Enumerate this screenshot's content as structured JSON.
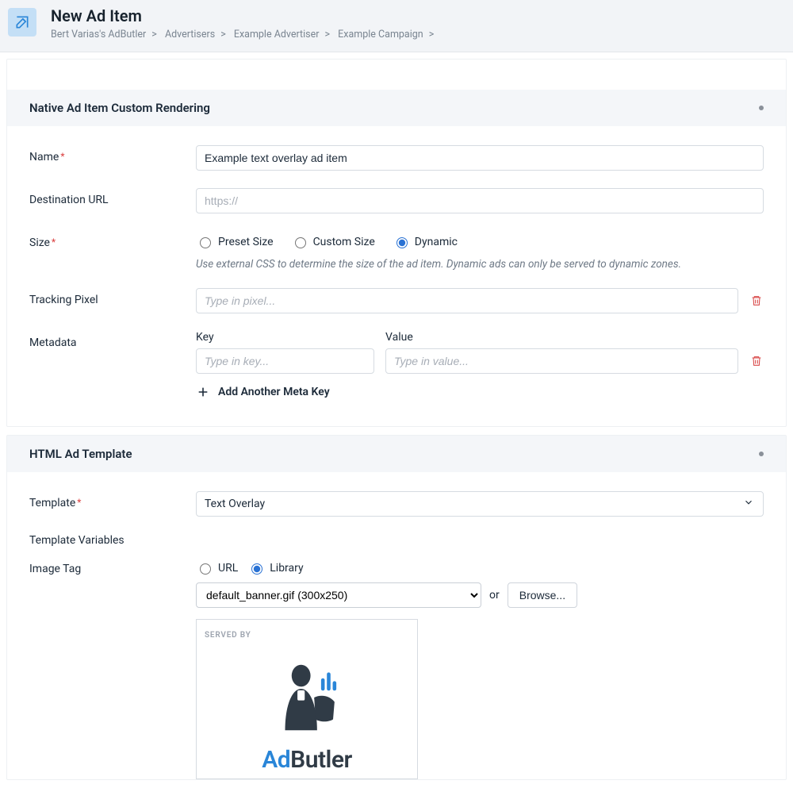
{
  "header": {
    "page_title": "New Ad Item",
    "breadcrumbs": [
      "Bert Varias's AdButler",
      "Advertisers",
      "Example Advertiser",
      "Example Campaign"
    ]
  },
  "section_native": {
    "title": "Native Ad Item Custom Rendering",
    "name_label": "Name",
    "name_value": "Example text overlay ad item",
    "dest_label": "Destination URL",
    "dest_placeholder": "https://",
    "size_label": "Size",
    "size_options": {
      "preset": "Preset Size",
      "custom": "Custom Size",
      "dynamic": "Dynamic"
    },
    "size_help": "Use external CSS to determine the size of the ad item. Dynamic ads can only be served to dynamic zones.",
    "tracking_label": "Tracking Pixel",
    "tracking_placeholder": "Type in pixel...",
    "metadata_label": "Metadata",
    "meta_key_label": "Key",
    "meta_value_label": "Value",
    "meta_key_placeholder": "Type in key...",
    "meta_value_placeholder": "Type in value...",
    "add_meta_label": "Add Another Meta Key"
  },
  "section_template": {
    "title": "HTML Ad Template",
    "template_label": "Template",
    "template_value": "Text Overlay",
    "variables_label": "Template Variables",
    "image_tag_label": "Image Tag",
    "source_options": {
      "url": "URL",
      "library": "Library"
    },
    "library_value": "default_banner.gif (300x250)",
    "or_text": "or",
    "browse_label": "Browse...",
    "served_by": "SERVED BY",
    "brand_blue": "Ad",
    "brand_dark": "Butler"
  }
}
